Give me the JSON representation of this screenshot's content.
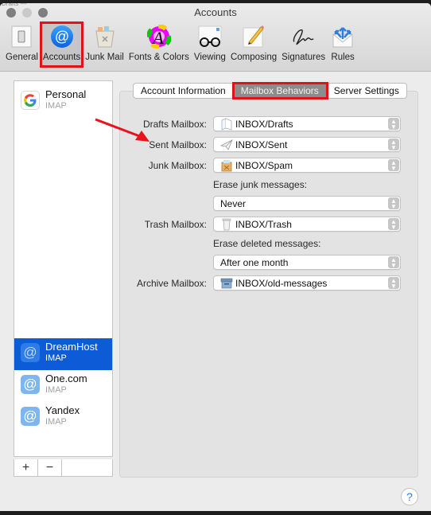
{
  "window": {
    "title": "Accounts",
    "ghost_title": "Drafts —"
  },
  "toolbar": {
    "items": [
      {
        "label": "General",
        "icon": "general-switch-icon",
        "selected": false
      },
      {
        "label": "Accounts",
        "icon": "at-sign-icon",
        "selected": true
      },
      {
        "label": "Junk Mail",
        "icon": "junk-trash-icon",
        "selected": false
      },
      {
        "label": "Fonts & Colors",
        "icon": "fonts-colors-icon",
        "selected": false
      },
      {
        "label": "Viewing",
        "icon": "viewing-glasses-icon",
        "selected": false
      },
      {
        "label": "Composing",
        "icon": "composing-pencil-icon",
        "selected": false
      },
      {
        "label": "Signatures",
        "icon": "signature-icon",
        "selected": false
      },
      {
        "label": "Rules",
        "icon": "rules-envelope-icon",
        "selected": false
      }
    ]
  },
  "sidebar": {
    "accounts": [
      {
        "name": "Personal",
        "type": "IMAP",
        "icon": "google-icon",
        "selected": false
      },
      {
        "name": "DreamHost",
        "type": "IMAP",
        "icon": "at-sign-icon",
        "selected": true
      },
      {
        "name": "One.com",
        "type": "IMAP",
        "icon": "at-sign-icon",
        "selected": false
      },
      {
        "name": "Yandex",
        "type": "IMAP",
        "icon": "at-sign-icon",
        "selected": false
      }
    ],
    "add_label": "+",
    "remove_label": "−"
  },
  "tabs": [
    {
      "label": "Account Information",
      "selected": false
    },
    {
      "label": "Mailbox Behaviors",
      "selected": true
    },
    {
      "label": "Server Settings",
      "selected": false
    }
  ],
  "form": {
    "drafts": {
      "label": "Drafts Mailbox:",
      "value": "INBOX/Drafts",
      "icon": "drafts-icon"
    },
    "sent": {
      "label": "Sent Mailbox:",
      "value": "INBOX/Sent",
      "icon": "sent-plane-icon"
    },
    "junk": {
      "label": "Junk Mailbox:",
      "value": "INBOX/Spam",
      "icon": "junk-icon"
    },
    "erase_junk": {
      "label": "Erase junk messages:",
      "value": "Never"
    },
    "trash": {
      "label": "Trash Mailbox:",
      "value": "INBOX/Trash",
      "icon": "trash-icon"
    },
    "erase_deleted": {
      "label": "Erase deleted messages:",
      "value": "After one month"
    },
    "archive": {
      "label": "Archive Mailbox:",
      "value": "INBOX/old-messages",
      "icon": "archive-box-icon"
    }
  },
  "help": {
    "label": "?"
  },
  "colors": {
    "highlight_box": "#e0121a",
    "selection_blue": "#0e5bd7",
    "help_blue": "#2a7de1"
  }
}
